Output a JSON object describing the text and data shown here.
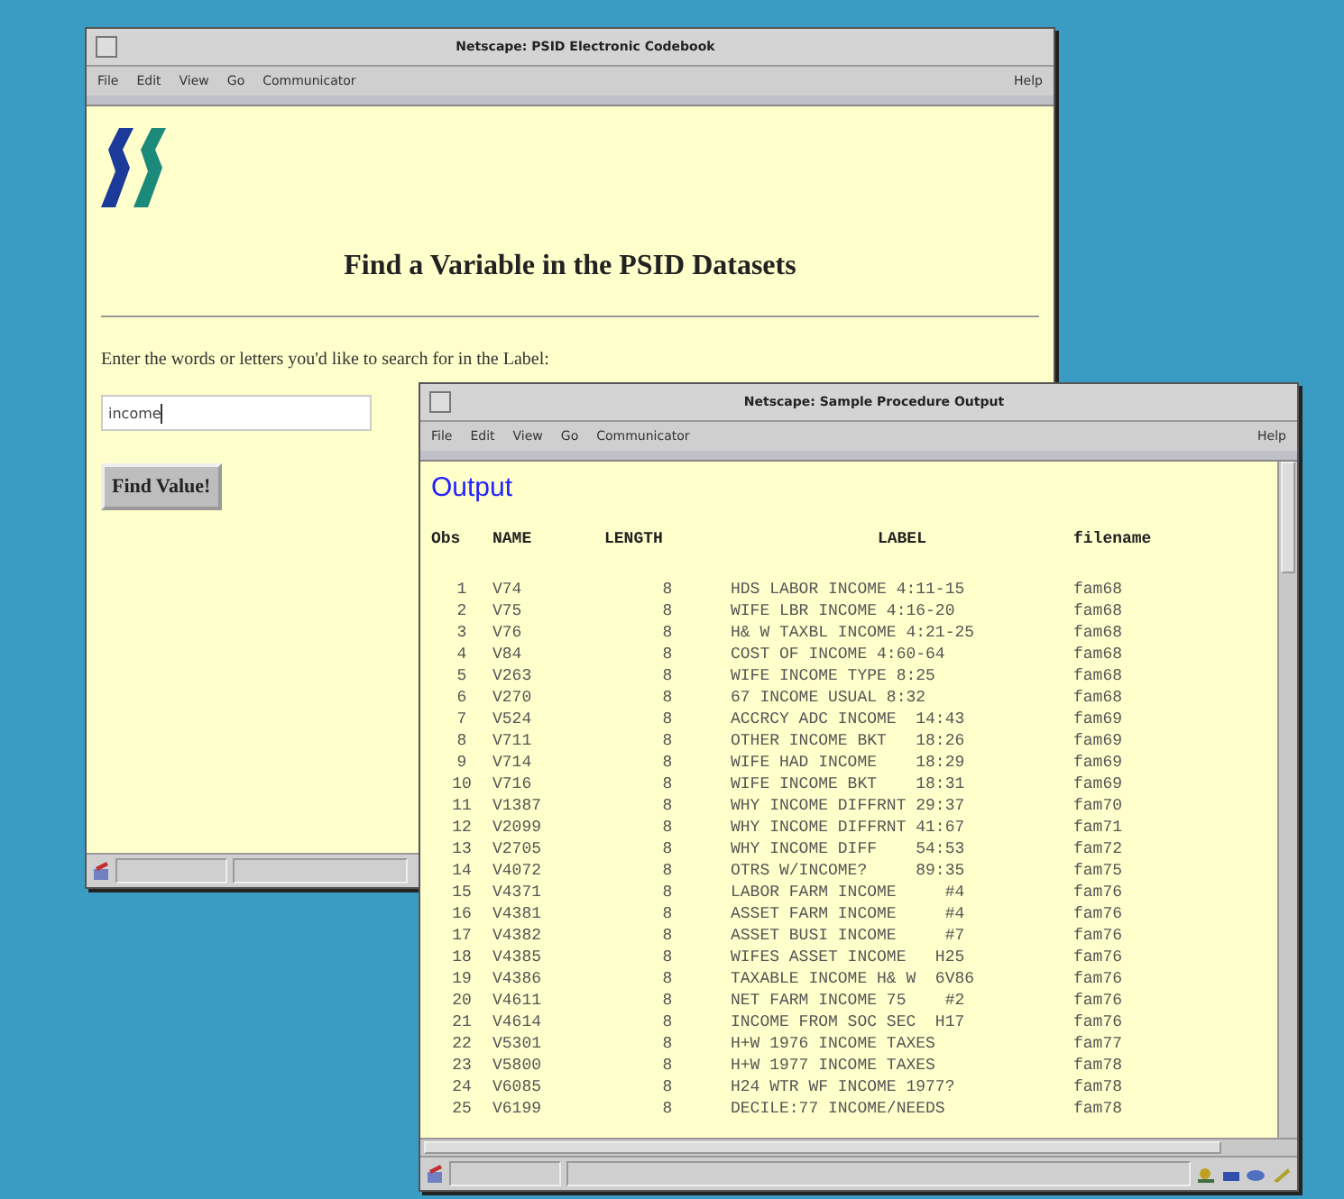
{
  "search_window": {
    "title": "Netscape: PSID Electronic Codebook",
    "menu": [
      "File",
      "Edit",
      "View",
      "Go",
      "Communicator"
    ],
    "help": "Help",
    "heading": "Find a Variable in the PSID Datasets",
    "prompt": "Enter the words or letters you'd like to search for in the Label:",
    "search": {
      "value": "income"
    },
    "button": "Find Value!"
  },
  "output_window": {
    "title": "Netscape: Sample Procedure Output",
    "menu": [
      "File",
      "Edit",
      "View",
      "Go",
      "Communicator"
    ],
    "help": "Help",
    "heading": "Output",
    "columns": [
      "Obs",
      "NAME",
      "LENGTH",
      "LABEL",
      "filename"
    ],
    "rows": [
      [
        "1",
        "V74",
        "8",
        "HDS LABOR INCOME 4:11-15",
        "fam68"
      ],
      [
        "2",
        "V75",
        "8",
        "WIFE LBR INCOME 4:16-20",
        "fam68"
      ],
      [
        "3",
        "V76",
        "8",
        "H& W TAXBL INCOME 4:21-25",
        "fam68"
      ],
      [
        "4",
        "V84",
        "8",
        "COST OF INCOME 4:60-64",
        "fam68"
      ],
      [
        "5",
        "V263",
        "8",
        "WIFE INCOME TYPE 8:25",
        "fam68"
      ],
      [
        "6",
        "V270",
        "8",
        "67 INCOME USUAL 8:32",
        "fam68"
      ],
      [
        "7",
        "V524",
        "8",
        "ACCRCY ADC INCOME  14:43",
        "fam69"
      ],
      [
        "8",
        "V711",
        "8",
        "OTHER INCOME BKT   18:26",
        "fam69"
      ],
      [
        "9",
        "V714",
        "8",
        "WIFE HAD INCOME    18:29",
        "fam69"
      ],
      [
        "10",
        "V716",
        "8",
        "WIFE INCOME BKT    18:31",
        "fam69"
      ],
      [
        "11",
        "V1387",
        "8",
        "WHY INCOME DIFFRNT 29:37",
        "fam70"
      ],
      [
        "12",
        "V2099",
        "8",
        "WHY INCOME DIFFRNT 41:67",
        "fam71"
      ],
      [
        "13",
        "V2705",
        "8",
        "WHY INCOME DIFF    54:53",
        "fam72"
      ],
      [
        "14",
        "V4072",
        "8",
        "OTRS W/INCOME?     89:35",
        "fam75"
      ],
      [
        "15",
        "V4371",
        "8",
        "LABOR FARM INCOME     #4",
        "fam76"
      ],
      [
        "16",
        "V4381",
        "8",
        "ASSET FARM INCOME     #4",
        "fam76"
      ],
      [
        "17",
        "V4382",
        "8",
        "ASSET BUSI INCOME     #7",
        "fam76"
      ],
      [
        "18",
        "V4385",
        "8",
        "WIFES ASSET INCOME   H25",
        "fam76"
      ],
      [
        "19",
        "V4386",
        "8",
        "TAXABLE INCOME H& W  6V86",
        "fam76"
      ],
      [
        "20",
        "V4611",
        "8",
        "NET FARM INCOME 75    #2",
        "fam76"
      ],
      [
        "21",
        "V4614",
        "8",
        "INCOME FROM SOC SEC  H17",
        "fam76"
      ],
      [
        "22",
        "V5301",
        "8",
        "H+W 1976 INCOME TAXES",
        "fam77"
      ],
      [
        "23",
        "V5800",
        "8",
        "H+W 1977 INCOME TAXES",
        "fam78"
      ],
      [
        "24",
        "V6085",
        "8",
        "H24 WTR WF INCOME 1977?",
        "fam78"
      ],
      [
        "25",
        "V6199",
        "8",
        "DECILE:77 INCOME/NEEDS",
        "fam78"
      ]
    ]
  }
}
